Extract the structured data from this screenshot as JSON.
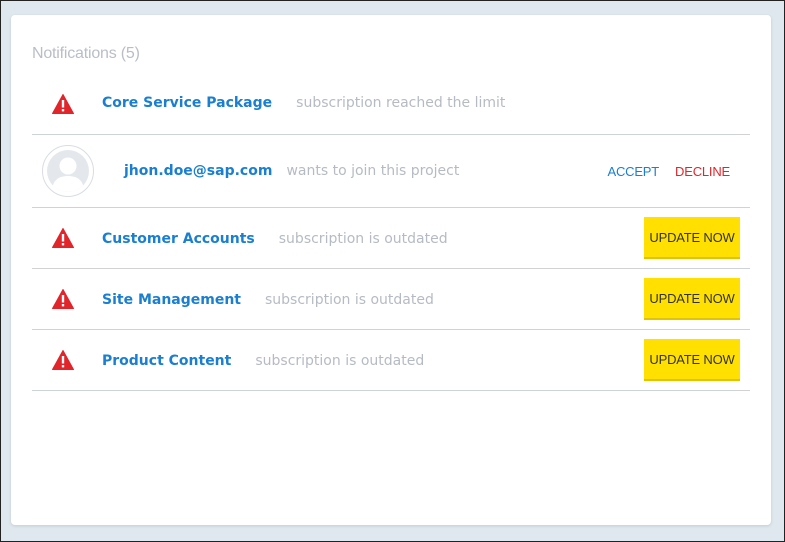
{
  "panel": {
    "title": "Notifications (5)"
  },
  "colors": {
    "accent": "#1a7fd0",
    "warning": "#e0252b",
    "update_button": "#ffe000",
    "muted_text": "#b6bbc3"
  },
  "notifications": [
    {
      "icon": "warning-icon",
      "name": "Core Service Package",
      "description": "subscription reached the limit"
    },
    {
      "icon": "avatar",
      "name": "jhon.doe@sap.com",
      "description": "wants to join this project",
      "accept_label": "ACCEPT",
      "decline_label": "DECLINE"
    },
    {
      "icon": "warning-icon",
      "name": "Customer Accounts",
      "description": "subscription is outdated",
      "action_label": "UPDATE NOW"
    },
    {
      "icon": "warning-icon",
      "name": "Site Management",
      "description": "subscription is outdated",
      "action_label": "UPDATE NOW"
    },
    {
      "icon": "warning-icon",
      "name": "Product Content",
      "description": "subscription is outdated",
      "action_label": "UPDATE NOW"
    }
  ]
}
